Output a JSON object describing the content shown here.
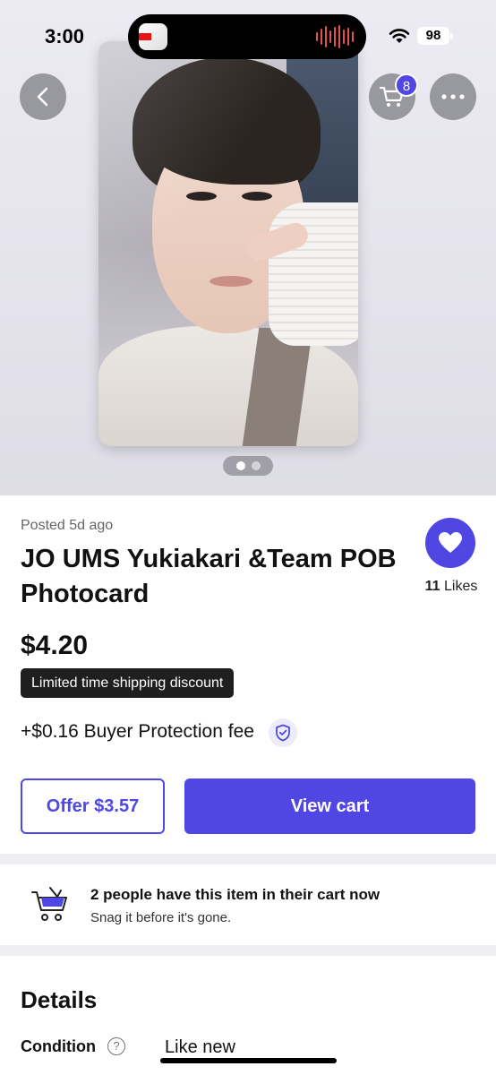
{
  "status_bar": {
    "time": "3:00",
    "battery": "98"
  },
  "nav": {
    "cart_count": "8"
  },
  "gallery": {
    "page_count": 2,
    "active_page": 1
  },
  "listing": {
    "posted": "Posted 5d ago",
    "title": "JO UMS Yukiakari &Team POB Photocard",
    "likes_count": "11",
    "likes_label": "Likes",
    "price": "$4.20",
    "shipping_badge": "Limited time shipping discount",
    "buyer_protection": "+$0.16 Buyer Protection fee"
  },
  "actions": {
    "offer_label": "Offer $3.57",
    "view_cart_label": "View cart"
  },
  "cart_notice": {
    "title": "2 people have this item in their cart now",
    "subtitle": "Snag it before it's gone."
  },
  "details": {
    "heading": "Details",
    "condition_label": "Condition",
    "condition_value": "Like new"
  },
  "colors": {
    "accent": "#5046e4",
    "badge_bg": "#1f1f1f"
  }
}
